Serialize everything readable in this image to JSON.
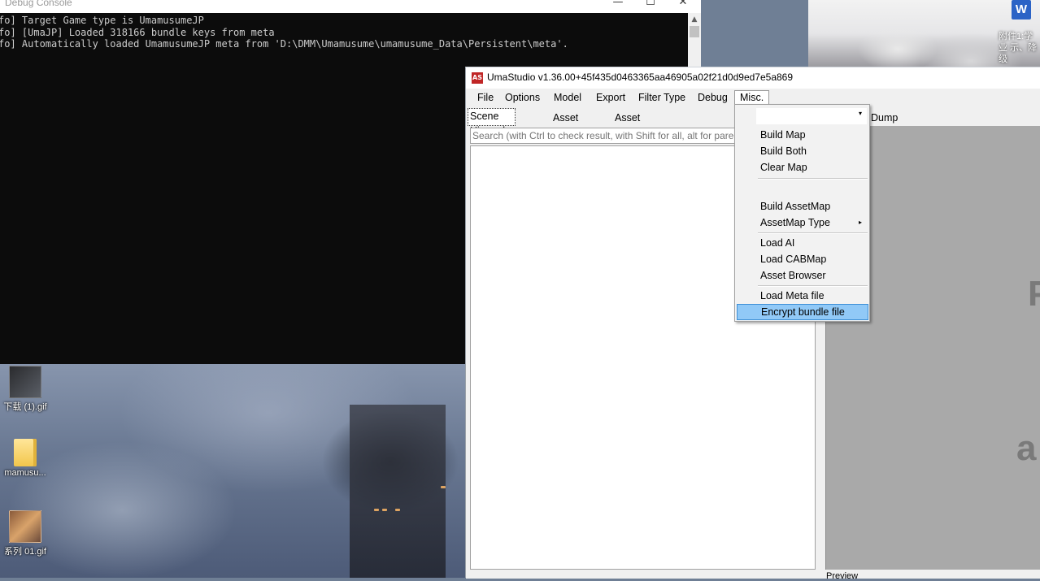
{
  "console": {
    "title": "Debug Console",
    "lines": [
      "fo] Target Game type is UmamusumeJP",
      "fo] [UmaJP] Loaded 318166 bundle keys from meta",
      "fo] Automatically loaded UmamusumeJP meta from 'D:\\DMM\\Umamusume\\umamusume_Data\\Persistent\\meta'."
    ],
    "controls": {
      "minimize": "—",
      "maximize": "☐",
      "close": "✕"
    }
  },
  "desktop": {
    "icons": [
      {
        "label": "下载 (1).gif"
      },
      {
        "label": "mamusu..."
      },
      {
        "label": "系列 01.gif"
      }
    ],
    "word_icon": {
      "glyph": "W",
      "label": "附件1:学业 示、降级"
    }
  },
  "uma": {
    "title": "UmaStudio v1.36.00+45f435d0463365aa46905a02f21d0d9ed7e5a869",
    "app_icon": "AS",
    "menu": [
      "File",
      "Options",
      "Model",
      "Export",
      "Filter Type",
      "Debug",
      "Misc."
    ],
    "tabs": [
      "Scene Hierarchy",
      "Asset List",
      "Asset Classes"
    ],
    "right_tab": "Dump",
    "search": {
      "placeholder": "Search (with Ctrl to check result, with Shift for all, alt for parent)",
      "value": ""
    },
    "right_panel_letters": [
      "P",
      "a"
    ],
    "preview_label": "Preview"
  },
  "misc_menu": {
    "combo_caret": "▾",
    "items": [
      {
        "label": "Build Map"
      },
      {
        "label": "Build Both"
      },
      {
        "label": "Clear Map"
      },
      {
        "label": "Build AssetMap"
      },
      {
        "label": "AssetMap Type",
        "submenu": true
      },
      {
        "label": "Load AI"
      },
      {
        "label": "Load CABMap"
      },
      {
        "label": "Asset Browser"
      },
      {
        "label": "Load Meta file"
      },
      {
        "label": "Encrypt bundle file",
        "highlighted": true
      }
    ],
    "submenu_arrow": "▸"
  },
  "colors": {
    "highlight": "#91c9f7",
    "console_bg": "#0c0c0c",
    "panel_gray": "#a9a9a9"
  }
}
